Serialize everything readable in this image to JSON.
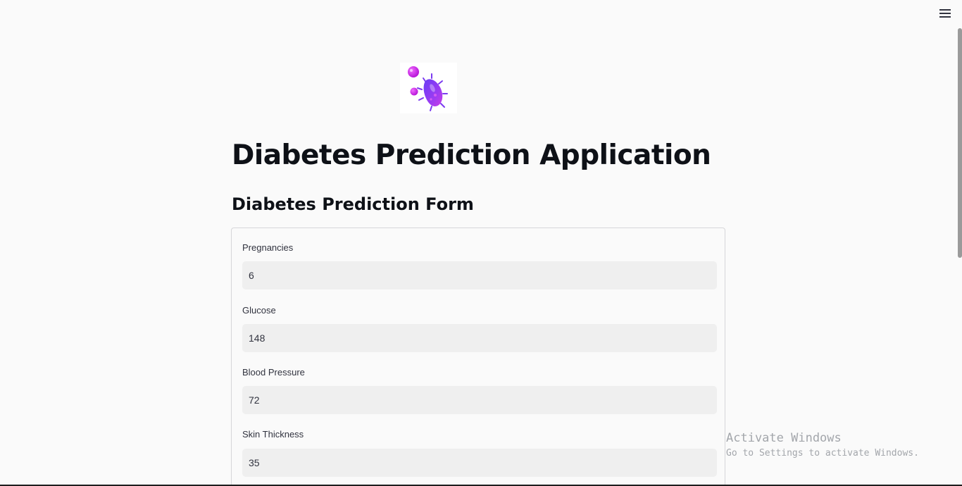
{
  "header": {
    "menu_icon": "hamburger-menu-icon"
  },
  "logo": {
    "icon": "bacteria-germ-icon",
    "colors": [
      "#8b2cf5",
      "#c31fe0",
      "#d41ee6"
    ]
  },
  "main": {
    "title": "Diabetes Prediction Application",
    "form_heading": "Diabetes Prediction Form",
    "fields": [
      {
        "label": "Pregnancies",
        "value": "6"
      },
      {
        "label": "Glucose",
        "value": "148"
      },
      {
        "label": "Blood Pressure",
        "value": "72"
      },
      {
        "label": "Skin Thickness",
        "value": "35"
      }
    ]
  },
  "watermark": {
    "title": "Activate Windows",
    "subtitle": "Go to Settings to activate Windows."
  }
}
